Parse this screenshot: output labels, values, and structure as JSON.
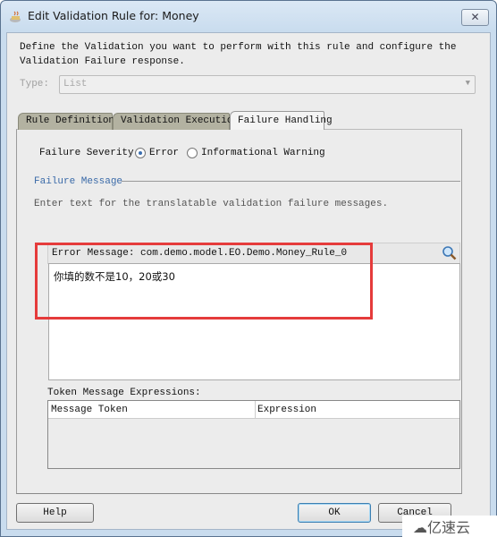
{
  "window": {
    "title": "Edit Validation Rule for: Money",
    "close_label": "✕"
  },
  "description": [
    "Define the Validation you want to perform with this rule and configure the",
    "Validation Failure response."
  ],
  "type": {
    "label": "Type:",
    "value": "List"
  },
  "tabs": [
    {
      "label": "Rule Definition"
    },
    {
      "label": "Validation Execution"
    },
    {
      "label": "Failure Handling",
      "active": true
    }
  ],
  "failure_severity": {
    "label": "Failure Severity",
    "options": [
      {
        "label": "Error",
        "selected": true
      },
      {
        "label": "Informational Warning",
        "selected": false
      }
    ]
  },
  "failure_message": {
    "section_title": "Failure Message",
    "hint": "Enter text for the translatable validation failure messages.",
    "error_message_label": "Error Message: com.demo.model.EO.Demo.Money_Rule_0",
    "error_message_value": "你填的数不是10，20或30"
  },
  "token_table": {
    "label": "Token Message Expressions:",
    "columns": [
      "Message Token",
      "Expression"
    ],
    "rows": []
  },
  "buttons": {
    "help": "Help",
    "ok": "OK",
    "cancel": "Cancel"
  },
  "watermark": "亿速云",
  "colors": {
    "highlight": "#e53b3b",
    "section_title": "#3a6aa8"
  }
}
